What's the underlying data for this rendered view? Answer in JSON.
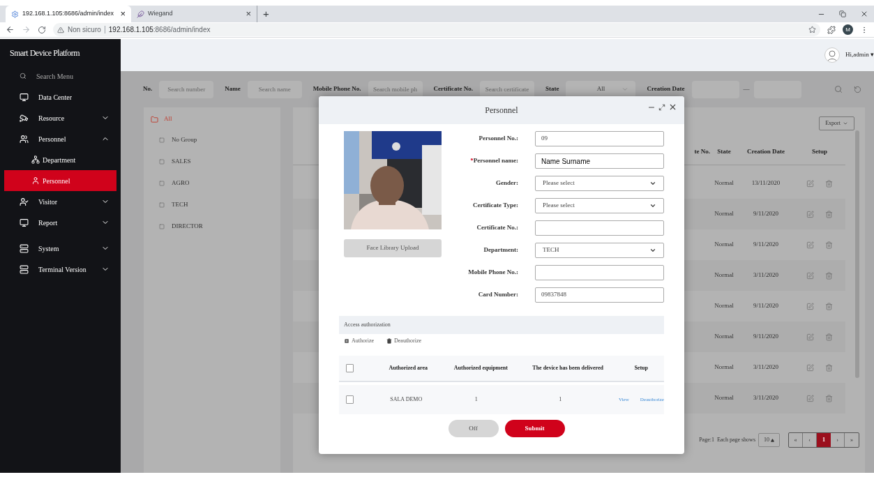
{
  "browser": {
    "tabs": [
      {
        "title": "192.168.1.105:8686/admin/index",
        "close": "×",
        "selected": true
      },
      {
        "title": "Wiegand",
        "close": "×",
        "selected": false
      }
    ],
    "new_tab": "+",
    "security": "Non sicuro",
    "url_host": "192.168.1.105",
    "url_path": ":8686/admin/index",
    "profile": "M"
  },
  "app": {
    "title": "Smart Device Platform",
    "user": "Hi,admin",
    "user_caret": "▾"
  },
  "sidebar": {
    "search": "Search Menu",
    "sections": [
      {
        "items": [
          {
            "label": "Data Center",
            "kind": "link",
            "selected": false
          },
          {
            "label": "Resource",
            "kind": "menu",
            "expanded": false,
            "selected": false
          },
          {
            "label": "Personnel",
            "kind": "menu",
            "expanded": true,
            "selected": false,
            "children": [
              {
                "label": "Department",
                "selected": false
              },
              {
                "label": "Personnel",
                "selected": true
              }
            ]
          },
          {
            "label": "Visitor",
            "kind": "menu",
            "expanded": false,
            "selected": false
          },
          {
            "label": "Report",
            "kind": "menu",
            "expanded": false,
            "selected": false
          }
        ]
      },
      {
        "items": [
          {
            "label": "System",
            "kind": "menu",
            "expanded": false,
            "selected": false
          },
          {
            "label": "Terminal Version",
            "kind": "menu",
            "expanded": false,
            "selected": false
          }
        ]
      }
    ]
  },
  "filters": [
    {
      "label": "No.",
      "kind": "input",
      "placeholder": "Search number"
    },
    {
      "label": "Name",
      "kind": "input",
      "placeholder": "Search name"
    },
    {
      "label": "Mobile Phone No.",
      "kind": "input",
      "placeholder": "Search mobile ph"
    },
    {
      "label": "Certificate No.",
      "kind": "input",
      "placeholder": "Search certificate"
    },
    {
      "label": "State",
      "kind": "select",
      "value": "All"
    },
    {
      "label": "Creation Date",
      "kind": "date_range",
      "separator": "—"
    }
  ],
  "groups": {
    "label": "All",
    "selected": true,
    "children": [
      {
        "label": "No Group",
        "selected": false
      },
      {
        "label": "SALES",
        "selected": false
      },
      {
        "label": "AGRO",
        "selected": false
      },
      {
        "label": "TECH",
        "selected": false
      },
      {
        "label": "DIRECTOR",
        "selected": false
      }
    ]
  },
  "table": {
    "export": "Export",
    "columns": [
      "te No.",
      "State",
      "Creation Date",
      "Setup"
    ],
    "rows": [
      {
        "state": "Normal",
        "creation_date": "13/11/2020"
      },
      {
        "state": "Normal",
        "creation_date": "9/11/2020"
      },
      {
        "state": "Normal",
        "creation_date": "9/11/2020"
      },
      {
        "state": "Normal",
        "creation_date": "3/11/2020"
      },
      {
        "state": "Normal",
        "creation_date": "9/11/2020"
      },
      {
        "state": "Normal",
        "creation_date": "9/11/2020"
      },
      {
        "state": "Normal",
        "creation_date": "3/11/2020"
      },
      {
        "state": "Normal",
        "creation_date": "3/11/2020"
      }
    ]
  },
  "pagination": {
    "page": "Page:1",
    "page_size_label": "Each page shows",
    "page_size": "10",
    "first": "«",
    "prev": "‹",
    "pages": [
      {
        "label": "1",
        "selected": true
      }
    ],
    "next": "›",
    "last": "»"
  },
  "modal": {
    "title": "Personnel",
    "upload_button": "Face Library Upload",
    "fields": [
      {
        "label": "Personnel No.:",
        "kind": "input",
        "value": "09"
      },
      {
        "label": "Personnel name:",
        "kind": "input",
        "value": "Name Surname",
        "required_mark": "*"
      },
      {
        "label": "Gender:",
        "kind": "select",
        "value": "Please select"
      },
      {
        "label": "Certificate Type:",
        "kind": "select",
        "value": "Please select"
      },
      {
        "label": "Certificate No.:",
        "kind": "input"
      },
      {
        "label": "Department:",
        "kind": "select",
        "value": "TECH"
      },
      {
        "label": "Mobile Phone No.:",
        "kind": "input"
      },
      {
        "label": "Card Number:",
        "kind": "input",
        "value": "09837848"
      }
    ],
    "access": {
      "title": "Access authorization",
      "actions": [
        {
          "label": "Authorize",
          "kind": "add"
        },
        {
          "label": "Deauthorize",
          "kind": "remove"
        }
      ],
      "header_checked": false,
      "columns": [
        "Authorized area",
        "Authorized equipment",
        "The device has been delivered",
        "Setup"
      ],
      "rows": [
        {
          "checked": false,
          "area": "SALA DEMO",
          "equipment": "1",
          "delivered": "1",
          "links": [
            "View",
            "Deauthorize"
          ]
        }
      ]
    },
    "buttons": [
      {
        "label": "Off",
        "kind": "secondary"
      },
      {
        "label": "Submit",
        "kind": "primary"
      }
    ]
  }
}
